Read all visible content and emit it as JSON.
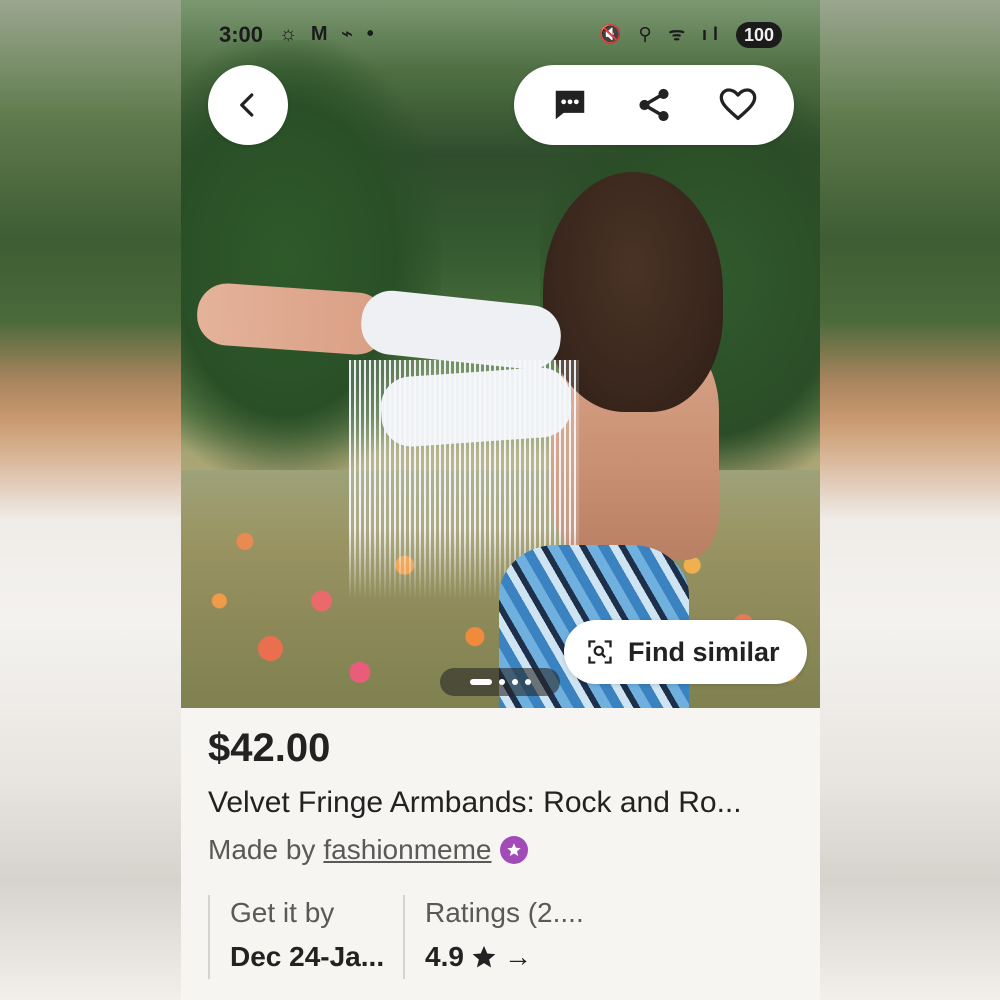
{
  "status_bar": {
    "time": "3:00",
    "left_icons": "☼ M ⌁ •",
    "right_icons": "🔇 ⚲ ᯤ ıl",
    "battery": "100"
  },
  "toolbar": {
    "back_icon": "chevron-left-icon",
    "message_icon": "message-icon",
    "share_icon": "share-icon",
    "favorite_icon": "heart-icon"
  },
  "image": {
    "find_similar_label": "Find similar",
    "page_dots": 4,
    "active_dot": 0
  },
  "listing": {
    "price": "$42.00",
    "title": "Velvet Fringe Armbands: Rock and Ro...",
    "made_by_prefix": "Made by",
    "shop_name": "fashionmeme"
  },
  "info": {
    "delivery_label": "Get it by",
    "delivery_value": "Dec 24-Ja...",
    "ratings_label": "Ratings (2....",
    "rating_value": "4.9",
    "arrow": "→"
  },
  "colors": {
    "star_seller_badge": "#a24bb8",
    "text_primary": "#222222",
    "text_secondary": "#595959"
  }
}
